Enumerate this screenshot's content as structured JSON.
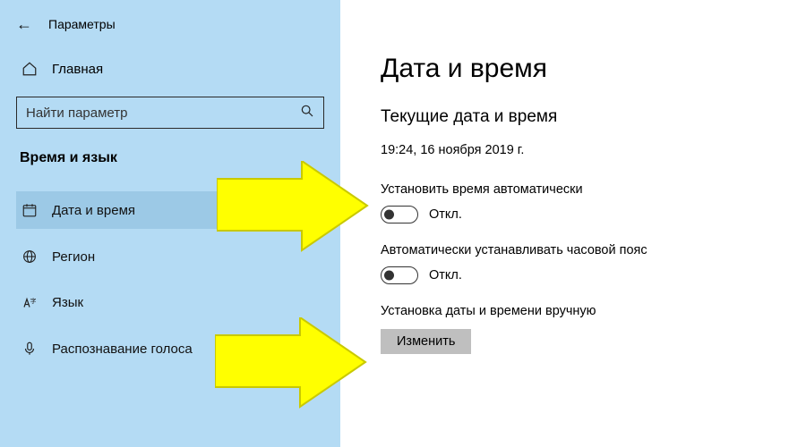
{
  "header": {
    "title": "Параметры"
  },
  "sidebar": {
    "home_label": "Главная",
    "search_placeholder": "Найти параметр",
    "section_title": "Время и язык",
    "items": [
      {
        "label": "Дата и время"
      },
      {
        "label": "Регион"
      },
      {
        "label": "Язык"
      },
      {
        "label": "Распознавание голоса"
      }
    ]
  },
  "page": {
    "title": "Дата и время",
    "current_heading": "Текущие дата и время",
    "current_value": "19:24, 16 ноября 2019 г.",
    "auto_time": {
      "label": "Установить время автоматически",
      "state": "Откл."
    },
    "auto_tz": {
      "label": "Автоматически устанавливать часовой пояс",
      "state": "Откл."
    },
    "manual": {
      "label": "Установка даты и времени вручную",
      "button": "Изменить"
    }
  }
}
